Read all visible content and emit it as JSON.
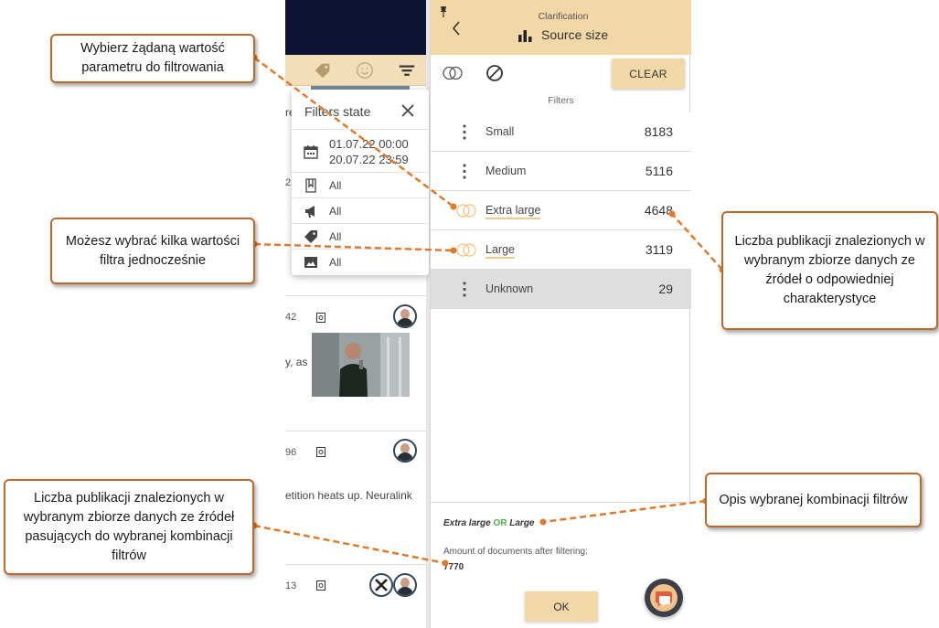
{
  "popup": {
    "title": "Filters state",
    "date_from": "01.07.22 00:00",
    "date_to": "20.07.22 23:59",
    "rows": [
      {
        "icon": "document-icon",
        "value": "All"
      },
      {
        "icon": "megaphone-icon",
        "value": "All"
      },
      {
        "icon": "tag-icon",
        "value": "All"
      },
      {
        "icon": "image-icon",
        "value": "All"
      }
    ]
  },
  "background": {
    "numbers": [
      "2",
      "42",
      "96",
      "13"
    ],
    "snippets": [
      "re",
      "y, as",
      "etition heats up. Neuralink"
    ]
  },
  "panel": {
    "subtitle": "Clarification",
    "title": "Source size",
    "clear_label": "CLEAR",
    "filters_label": "Filters",
    "filters": [
      {
        "label": "Small",
        "count": "8183",
        "selected": false,
        "unknown": false
      },
      {
        "label": "Medium",
        "count": "5116",
        "selected": false,
        "unknown": false
      },
      {
        "label": "Extra large",
        "count": "4648",
        "selected": true,
        "unknown": false
      },
      {
        "label": "Large",
        "count": "3119",
        "selected": true,
        "unknown": false
      },
      {
        "label": "Unknown",
        "count": "29",
        "selected": false,
        "unknown": true
      }
    ],
    "combo_a": "Extra large",
    "combo_op": "OR",
    "combo_b": "Large",
    "amount_label": "Amount of documents after filtering:",
    "amount_value": "7770",
    "ok_label": "OK"
  },
  "callouts": {
    "select_value": "Wybierz żądaną wartość parametru do filtrowania",
    "multi_select": "Możesz wybrać kilka wartości filtra jednocześnie",
    "count_per_value": "Liczba publikacji znalezionych w wybranym zbiorze danych ze źródeł o odpowiedniej charakterystyce",
    "combo_description": "Opis wybranej kombinacji filtrów",
    "total_count": "Liczba publikacji znalezionych w wybranym zbiorze danych ze źródeł pasujących do wybranej kombinacji filtrów"
  },
  "colors": {
    "accent": "#f2d7a7",
    "callout_border": "#c0672a",
    "or_operator": "#4caf50",
    "header_dark": "#0f1432"
  }
}
